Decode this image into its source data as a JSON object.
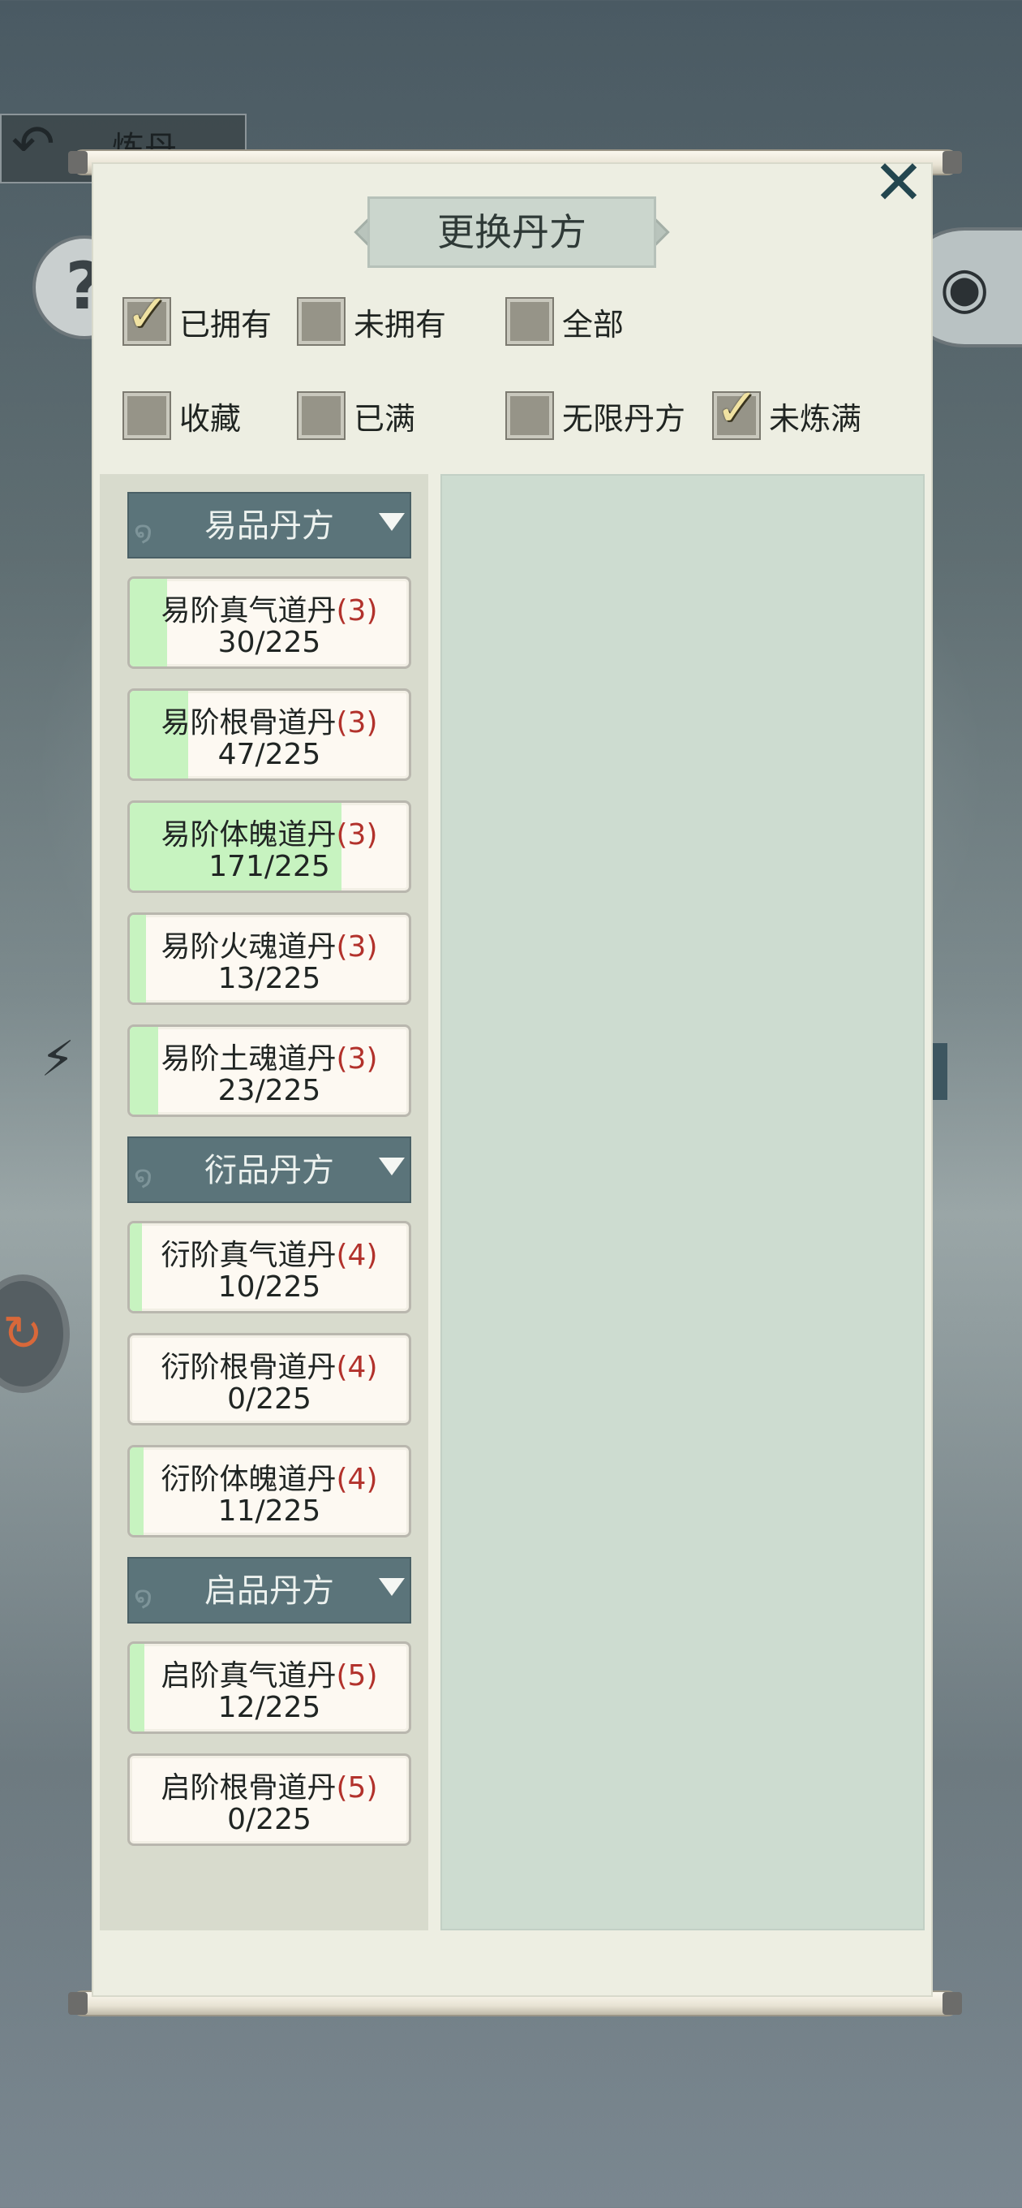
{
  "header": {
    "back_label": "炼丹"
  },
  "dialog": {
    "title": "更换丹方",
    "filters": [
      {
        "label": "已拥有",
        "checked": true
      },
      {
        "label": "未拥有",
        "checked": false
      },
      {
        "label": "全部",
        "checked": false
      },
      {
        "label": "收藏",
        "checked": false
      },
      {
        "label": "已满",
        "checked": false
      },
      {
        "label": "无限丹方",
        "checked": false
      },
      {
        "label": "未炼满",
        "checked": true
      }
    ],
    "groups": [
      {
        "title": "易品丹方"
      },
      {
        "title": "衍品丹方"
      },
      {
        "title": "启品丹方"
      }
    ],
    "items": [
      {
        "name": "易阶真气道丹",
        "tier": "(3)",
        "count": "30/225",
        "progress": 0.133
      },
      {
        "name": "易阶根骨道丹",
        "tier": "(3)",
        "count": "47/225",
        "progress": 0.209
      },
      {
        "name": "易阶体魄道丹",
        "tier": "(3)",
        "count": "171/225",
        "progress": 0.76
      },
      {
        "name": "易阶火魂道丹",
        "tier": "(3)",
        "count": "13/225",
        "progress": 0.058
      },
      {
        "name": "易阶土魂道丹",
        "tier": "(3)",
        "count": "23/225",
        "progress": 0.102
      },
      {
        "name": "衍阶真气道丹",
        "tier": "(4)",
        "count": "10/225",
        "progress": 0.044
      },
      {
        "name": "衍阶根骨道丹",
        "tier": "(4)",
        "count": "0/225",
        "progress": 0
      },
      {
        "name": "衍阶体魄道丹",
        "tier": "(4)",
        "count": "11/225",
        "progress": 0.049
      },
      {
        "name": "启阶真气道丹",
        "tier": "(5)",
        "count": "12/225",
        "progress": 0.053
      },
      {
        "name": "启阶根骨道丹",
        "tier": "(5)",
        "count": "0/225",
        "progress": 0
      }
    ]
  },
  "icons": {
    "back": "back-arrow-icon",
    "help": "question-icon",
    "view": "eye-icon",
    "close": "close-icon",
    "check": "checkmark-icon",
    "expand": "triangle-down-icon"
  },
  "colors": {
    "progress_fill": "#c7f3c0",
    "tier_number": "#b2322c",
    "group_header": "#5b747a"
  }
}
